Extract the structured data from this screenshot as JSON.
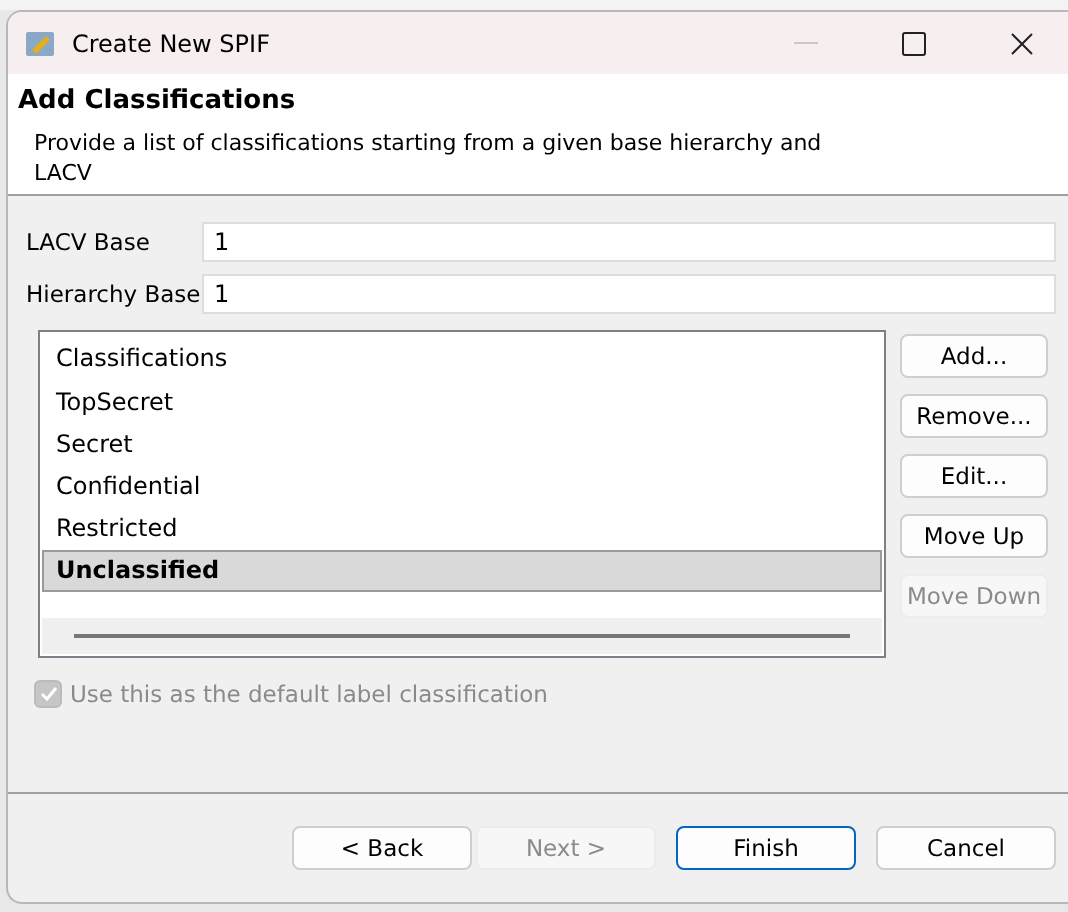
{
  "window": {
    "title": "Create New SPIF"
  },
  "header": {
    "title": "Add Classifications",
    "description": "Provide a list of classifications starting from a given base hierarchy and LACV"
  },
  "fields": [
    {
      "label": "LACV Base",
      "value": "1"
    },
    {
      "label": "Hierarchy Base",
      "value": "1"
    }
  ],
  "list": {
    "heading": "Classifications",
    "items": [
      {
        "label": "TopSecret",
        "selected": false
      },
      {
        "label": "Secret",
        "selected": false
      },
      {
        "label": "Confidential",
        "selected": false
      },
      {
        "label": "Restricted",
        "selected": false
      },
      {
        "label": "Unclassified",
        "selected": true
      }
    ]
  },
  "side_buttons": [
    {
      "label": "Add...",
      "disabled": false
    },
    {
      "label": "Remove...",
      "disabled": false
    },
    {
      "label": "Edit...",
      "disabled": false
    },
    {
      "label": "Move Up",
      "disabled": false
    },
    {
      "label": "Move Down",
      "disabled": true
    }
  ],
  "default_checkbox": {
    "label": "Use this as the default label classification",
    "checked": true,
    "disabled": true
  },
  "footer_buttons": [
    {
      "label": "< Back",
      "disabled": false,
      "default": false
    },
    {
      "label": "Next >",
      "disabled": true,
      "default": false
    },
    {
      "label": "Finish",
      "disabled": false,
      "default": true
    },
    {
      "label": "Cancel",
      "disabled": false,
      "default": false
    }
  ]
}
